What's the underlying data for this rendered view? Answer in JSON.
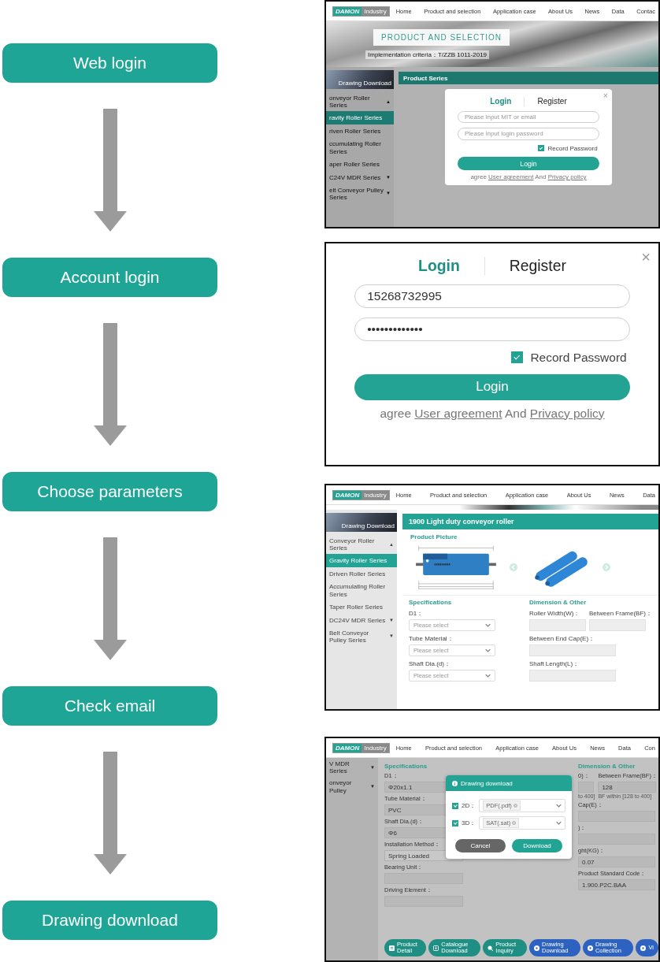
{
  "steps": [
    {
      "label": "Web login"
    },
    {
      "label": "Account login"
    },
    {
      "label": "Choose parameters"
    },
    {
      "label": "Check email"
    },
    {
      "label": "Drawing download"
    }
  ],
  "panels": [
    {
      "kind": "web_login",
      "logo": {
        "brand": "DAMON",
        "tag": "Industry"
      },
      "nav": [
        "Home",
        "Product and selection",
        "Application case",
        "About Us",
        "News",
        "Data",
        "Contac"
      ],
      "banner": {
        "title": "PRODUCT AND SELECTION",
        "criteria": "Implementation criteria：T/ZZB 1011-2019"
      },
      "sidebar": {
        "image_label": "Drawing Download",
        "items": [
          {
            "label": "onveyor Roller Series",
            "arrow": "▲",
            "selected": false
          },
          {
            "label": "ravity Roller Series",
            "selected": true
          },
          {
            "label": "riven Roller Series",
            "selected": false
          },
          {
            "label": "ccumulating Roller Series",
            "selected": false
          },
          {
            "label": "aper Roller Series",
            "selected": false
          },
          {
            "label": "C24V MDR Series",
            "arrow": "▼",
            "selected": false
          },
          {
            "label": "elt Conveyor Pulley Series",
            "arrow": "▼",
            "selected": false
          }
        ]
      },
      "section_title": "Product Series",
      "login": {
        "tabs": [
          {
            "label": "Login",
            "selected": true
          },
          {
            "label": "Register",
            "selected": false
          }
        ],
        "close": "×",
        "fields": [
          {
            "placeholder": "Please input MIT or email"
          },
          {
            "placeholder": "Please input login password"
          }
        ],
        "remember": {
          "label": "Record Password",
          "checked": true
        },
        "button": "Login",
        "agree": {
          "prefix": "agree",
          "link1": "User agreement",
          "middle": "And",
          "link2": "Privacy policy"
        }
      }
    },
    {
      "kind": "login_dialog",
      "login": {
        "tabs": [
          {
            "label": "Login",
            "selected": true
          },
          {
            "label": "Register",
            "selected": false
          }
        ],
        "close": "×",
        "fields": [
          {
            "value": "15268732995"
          },
          {
            "value": "•••••••••••••"
          }
        ],
        "remember": {
          "label": "Record Password",
          "checked": true
        },
        "button": "Login",
        "agree": {
          "prefix": "agree",
          "link1": "User agreement",
          "middle": "And",
          "link2": "Privacy policy"
        }
      }
    },
    {
      "kind": "parameters",
      "logo": {
        "brand": "DAMON",
        "tag": "Industry"
      },
      "nav": [
        "Home",
        "Product and selection",
        "Application case",
        "About Us",
        "News",
        "Data"
      ],
      "sidebar": {
        "image_label": "Drawing Download",
        "items": [
          {
            "label": "Conveyor Roller Series",
            "arrow": "▲",
            "selected": false
          },
          {
            "label": "Gravity Roller Series",
            "selected": true
          },
          {
            "label": "Driven Roller Series",
            "selected": false
          },
          {
            "label": "Accumulating Roller Series",
            "selected": false
          },
          {
            "label": "Taper Roller Series",
            "selected": false
          },
          {
            "label": "DC24V MDR Series",
            "arrow": "▼",
            "selected": false
          },
          {
            "label": "Belt Conveyor Pulley Series",
            "arrow": "▼",
            "selected": false
          }
        ]
      },
      "title": "1900 Light duty conveyor roller",
      "picture_heading": "Product Picture",
      "specifications": {
        "heading": "Specifications",
        "fields": [
          {
            "label": "D1：",
            "placeholder": "Please select"
          },
          {
            "label": "Tube Material：",
            "placeholder": "Please select"
          },
          {
            "label": "Shaft Dia.(d)：",
            "placeholder": "Please select"
          }
        ]
      },
      "dimensions": {
        "heading": "Dimension & Other",
        "rows": [
          {
            "fields": [
              {
                "label": "Roller Width(W)："
              },
              {
                "label": "Between Frame(BF)："
              }
            ]
          },
          {
            "fields": [
              {
                "label": "Between End Cap(E)："
              }
            ]
          },
          {
            "fields": [
              {
                "label": "Shaft Length(L)："
              }
            ]
          }
        ]
      }
    },
    {
      "kind": "download",
      "logo": {
        "brand": "DAMON",
        "tag": "Industry"
      },
      "nav": [
        "Home",
        "Product and selection",
        "Application case",
        "About Us",
        "News",
        "Data",
        "Con"
      ],
      "sidebar": {
        "items": [
          {
            "label": "V MDR Series",
            "arrow": "▼",
            "selected": false
          },
          {
            "label": "onveyor Pulley",
            "arrow": "▼",
            "selected": false
          }
        ]
      },
      "specifications": {
        "heading": "Specifications",
        "fields": [
          {
            "label": "D1：",
            "value": "Φ20x1.1",
            "kind": "input"
          },
          {
            "label": "Tube Material：",
            "value": "PVC",
            "kind": "input"
          },
          {
            "label": "Shaft Dia.(d)：",
            "value": "Φ6",
            "kind": "input"
          },
          {
            "label": "Installation Method：",
            "value": "Spring Loaded",
            "kind": "select"
          },
          {
            "label": "Bearing Unit：",
            "kind": "input"
          },
          {
            "label": "Driving Element：",
            "kind": "input"
          }
        ]
      },
      "dimensions": {
        "heading": "Dimension & Other",
        "rows": [
          {
            "fields": [
              {
                "label": "0)：",
                "note": "to 400]"
              },
              {
                "label": "Between Frame(BF)：",
                "value": "128",
                "note": "BF within [128 to 400]"
              }
            ]
          },
          {
            "fields": [
              {
                "label": "Cap(E)："
              }
            ]
          },
          {
            "fields": [
              {
                "label": ")："
              }
            ]
          },
          {
            "fields": [
              {
                "label": "ght(KG)：",
                "value": "0.07"
              }
            ]
          },
          {
            "fields": [
              {
                "label": "Product Standard Code：",
                "value": "1.900.P2C.BAA"
              }
            ]
          }
        ]
      },
      "modal": {
        "title": "Drawing download",
        "rows": [
          {
            "label": "2D：",
            "checked": true,
            "tag": "PDF(.pdf)"
          },
          {
            "label": "3D：",
            "checked": true,
            "tag": "SAT(.sat)"
          }
        ],
        "buttons": [
          {
            "label": "Cancel",
            "kind": "cancel"
          },
          {
            "label": "Download",
            "kind": "primary"
          }
        ]
      },
      "actions": [
        {
          "label": "Product Detail",
          "color": "#1f8f84",
          "kind": "document"
        },
        {
          "label": "Catalogue Download",
          "color": "#1f8f84",
          "kind": "download"
        },
        {
          "label": "Product Inquiry",
          "color": "#1f8f84",
          "kind": "search"
        },
        {
          "label": "Drawing Download",
          "color": "#2d62c0",
          "kind": "circle"
        },
        {
          "label": "Drawing Collection",
          "color": "#2d62c0",
          "kind": "circle"
        },
        {
          "label": "Vi",
          "color": "#2d62c0",
          "kind": "circle"
        }
      ]
    }
  ]
}
